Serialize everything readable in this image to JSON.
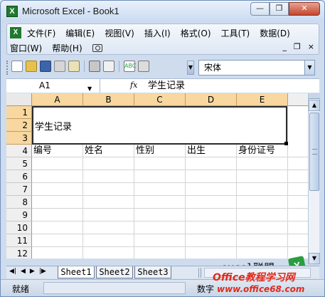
{
  "window": {
    "title": "Microsoft Excel - Book1",
    "app_icon": "X",
    "controls": [
      "minimize",
      "restore",
      "close"
    ]
  },
  "menubar": {
    "row1": [
      "文件(F)",
      "编辑(E)",
      "视图(V)",
      "插入(I)",
      "格式(O)",
      "工具(T)",
      "数据(D)"
    ],
    "row2": [
      "窗口(W)",
      "帮助(H)"
    ],
    "doc_controls": [
      "_",
      "×"
    ]
  },
  "toolbar": {
    "font_name": "宋体"
  },
  "formula_bar": {
    "name_box": "A1",
    "fx": "fx",
    "content": "学生记录"
  },
  "grid": {
    "columns": [
      "A",
      "B",
      "C",
      "D",
      "E"
    ],
    "rows": [
      "1",
      "2",
      "3",
      "4",
      "5",
      "6",
      "7",
      "8",
      "9",
      "10",
      "11",
      "12"
    ],
    "merged_title": "学生记录",
    "row4_headers": [
      "编号",
      "姓名",
      "性别",
      "出生",
      "身份证号"
    ]
  },
  "sheet_tabs": [
    "Sheet1",
    "Sheet2",
    "Sheet3"
  ],
  "status": {
    "ready": "就绪",
    "mode": "数字"
  },
  "watermarks": {
    "site_cn": "excel联盟",
    "brand": "Office教程学习网",
    "url": "www.office68.com"
  }
}
